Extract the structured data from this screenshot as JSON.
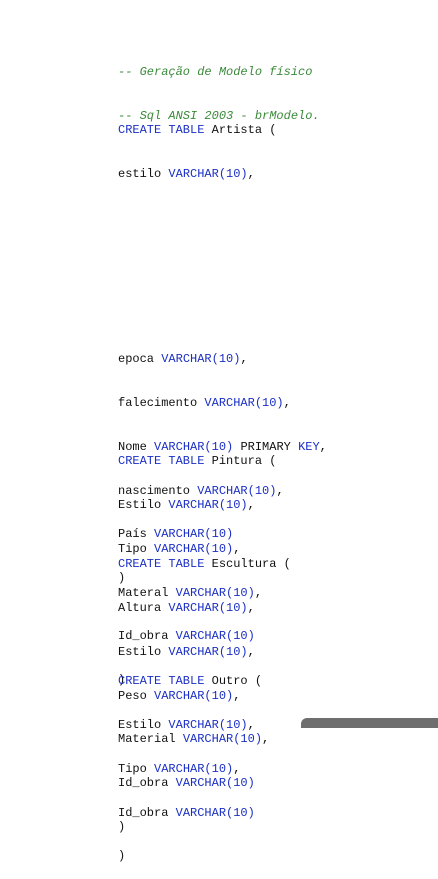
{
  "comments": [
    "-- Geração de Modelo físico",
    "-- Sql ANSI 2003 - brModelo."
  ],
  "keywords": {
    "create_table": "CREATE TABLE",
    "varchar10": "VARCHAR(10)",
    "primary": "PRIMARY",
    "key": "KEY"
  },
  "blocks": {
    "artista": {
      "name": "Artista",
      "line_estilo": "estilo",
      "line_epoca": "epoca",
      "line_falecimento": "falecimento",
      "line_nome": "Nome",
      "line_nascimento": "nascimento",
      "line_pais": "País"
    },
    "pintura": {
      "name": "Pintura",
      "line_estilo": "Estilo",
      "line_tipo": "Tipo",
      "line_materal": "Materal",
      "line_id_obra": "Id_obra"
    },
    "escultura": {
      "name": "Escultura",
      "line_altura": "Altura",
      "line_estilo": "Estilo",
      "line_peso": "Peso",
      "line_material": "Material",
      "line_id_obra": "Id_obra"
    },
    "outro": {
      "name": "Outro",
      "line_estilo": "Estilo",
      "line_tipo": "Tipo",
      "line_id_obra": "Id_obra"
    }
  },
  "punct": {
    "open": " (",
    "close": ")",
    "comma": ","
  }
}
